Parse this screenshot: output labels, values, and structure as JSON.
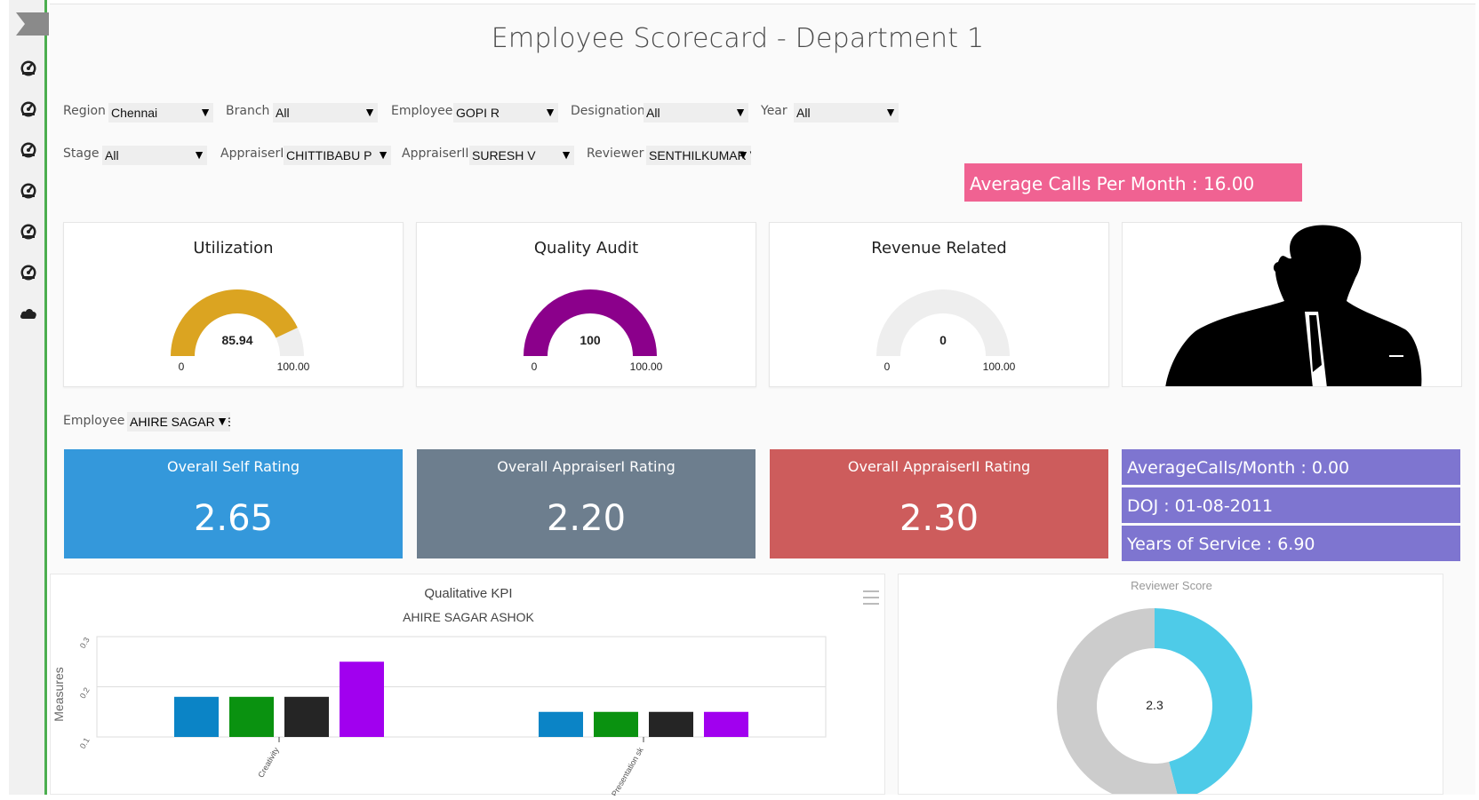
{
  "title": "Employee Scorecard - Department 1",
  "sidebar": {
    "icons": [
      "dashboard-icon",
      "dashboard-icon",
      "dashboard-icon",
      "dashboard-icon",
      "dashboard-icon",
      "dashboard-icon",
      "cloud-icon"
    ]
  },
  "filters": {
    "region": {
      "label": "Region",
      "value": "Chennai"
    },
    "branch": {
      "label": "Branch",
      "value": "All"
    },
    "employee": {
      "label": "Employee",
      "value": "GOPI R"
    },
    "designation": {
      "label": "Designation",
      "value": "All"
    },
    "year": {
      "label": "Year",
      "value": "All"
    },
    "stage": {
      "label": "Stage",
      "value": "All"
    },
    "appraiser1": {
      "label": "AppraiserI",
      "value": "CHITTIBABU P"
    },
    "appraiser2": {
      "label": "AppraiserII",
      "value": "SURESH V"
    },
    "reviewer": {
      "label": "Reviewer",
      "value": "SENTHILKUMAR V"
    }
  },
  "average_calls_banner": "Average Calls Per Month : 16.00",
  "gauges": [
    {
      "title": "Utilization",
      "value": 85.94,
      "value_label": "85.94",
      "min_label": "0",
      "max_label": "100.00",
      "max": 100,
      "color": "#dba421"
    },
    {
      "title": "Quality Audit",
      "value": 100,
      "value_label": "100",
      "min_label": "0",
      "max_label": "100.00",
      "max": 100,
      "color": "#8b008b"
    },
    {
      "title": "Revenue Related",
      "value": 0,
      "value_label": "0",
      "min_label": "0",
      "max_label": "100.00",
      "max": 100,
      "color": "#cccccc"
    }
  ],
  "employee2": {
    "label": "Employee",
    "value": "AHIRE SAGAR ASHOK"
  },
  "ratings": [
    {
      "title": "Overall Self Rating",
      "value": "2.65",
      "color": "#3498db"
    },
    {
      "title": "Overall AppraiserI Rating",
      "value": "2.20",
      "color": "#6d7e8e"
    },
    {
      "title": "Overall AppraiserII Rating",
      "value": "2.30",
      "color": "#cd5c5c"
    }
  ],
  "info": {
    "calls": "AverageCalls/Month : 0.00",
    "doj": "DOJ : 01-08-2011",
    "service": "Years of Service : 6.90"
  },
  "chart_data": [
    {
      "type": "bar",
      "title": "Qualitative KPI",
      "subtitle": "AHIRE SAGAR ASHOK",
      "ylabel": "Measures",
      "ylim": [
        0.1,
        0.3
      ],
      "yticks": [
        "0.1",
        "0.2",
        "0.3"
      ],
      "categories": [
        "Creativity",
        "Presentation sk"
      ],
      "series": [
        {
          "values": [
            0.18,
            0.15
          ],
          "color": "#0b84c6"
        },
        {
          "values": [
            0.18,
            0.15
          ],
          "color": "#0a9210"
        },
        {
          "values": [
            0.18,
            0.15
          ],
          "color": "#252525"
        },
        {
          "values": [
            0.25,
            0.15
          ],
          "color": "#a100ef"
        }
      ]
    },
    {
      "type": "pie",
      "title": "Reviewer Score",
      "center_label": "2.3",
      "values": [
        2.3,
        2.7
      ],
      "colors": [
        "#4ecbe8",
        "#cccccc"
      ]
    }
  ]
}
